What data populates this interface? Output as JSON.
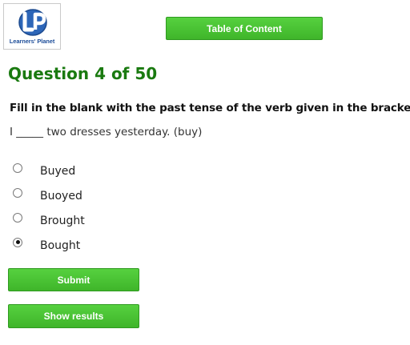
{
  "logo": {
    "letters": "LP",
    "text": "Learners' Planet"
  },
  "header": {
    "toc_label": "Table of Content"
  },
  "question": {
    "title": "Question 4 of 50",
    "instruction": "Fill in the blank with the past tense of the verb given in the bracket:",
    "prompt": "I _____ two dresses yesterday. (buy)",
    "selected_option": "Bought",
    "options": [
      {
        "label": "Buyed",
        "checked": false
      },
      {
        "label": "Buoyed",
        "checked": false
      },
      {
        "label": "Brought",
        "checked": false
      },
      {
        "label": "Bought",
        "checked": true
      }
    ]
  },
  "actions": {
    "submit_label": "Submit",
    "show_results_label": "Show results"
  },
  "colors": {
    "button_green": "#46c133",
    "title_green": "#1a7a10",
    "logo_blue": "#1f4f9a"
  }
}
